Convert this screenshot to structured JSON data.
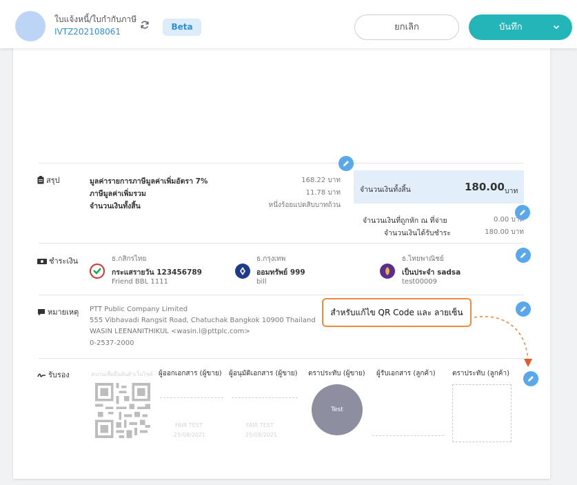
{
  "header": {
    "doc_type": "ใบแจ้งหนี้/ใบกำกับภาษี",
    "doc_number": "IVTZ202108061",
    "beta_label": "Beta",
    "cancel_label": "ยกเลิก",
    "save_label": "บันทึก"
  },
  "colors": {
    "accent": "#24b5b9",
    "link": "#2f8fd8",
    "edit_button": "#5aa8ec",
    "callout_border": "#f08a3c",
    "total_box": "#e3eefb"
  },
  "summary": {
    "label": "สรุป",
    "rows": [
      {
        "label": "มูลค่ารายการภาษีมูลค่าเพิ่มอัตรา 7%",
        "value": "168.22 บาท"
      },
      {
        "label": "ภาษีมูลค่าเพิ่มรวม",
        "value": "11.78 บาท"
      },
      {
        "label": "จำนวนเงินทั้งสิ้น",
        "value": "หนึ่งร้อยแปดสิบบาทถ้วน"
      }
    ],
    "total_label": "จำนวนเงินทั้งสิ้น",
    "total_value": "180.00",
    "total_unit": "บาท",
    "withheld_label": "จำนวนเงินที่ถูกหัก ณ ที่จ่าย",
    "withheld_value": "0.00 บาท",
    "received_label": "จำนวนเงินได้รับชำระ",
    "received_value": "180.00 บาท"
  },
  "payment": {
    "label": "ชำระเงิน",
    "banks": [
      {
        "bank": "ธ.กสิกรไทย",
        "account": "กระแสรายวัน 123456789",
        "note": "Friend BBL 1111",
        "icon": "kasikorn-logo-icon",
        "color": "#1ba94c"
      },
      {
        "bank": "ธ.กรุงเทพ",
        "account": "ออมทรัพย์ 999",
        "note": "bill",
        "icon": "bangkok-bank-logo-icon",
        "color": "#1e3a8a"
      },
      {
        "bank": "ธ.ไทยพาณิชย์",
        "account": "เป็นประจำ sadsa",
        "note": "test00009",
        "icon": "scb-logo-icon",
        "color": "#5b2d8e"
      }
    ]
  },
  "remark": {
    "label": "หมายเหตุ",
    "lines": [
      "PTT Public Company Limited",
      "555 Vibhavadi Rangsit Road, Chatuchak Bangkok 10900 Thailand",
      "WASIN LEENANITHIKUL <wasin.l@pttplc.com>",
      "0-2537-2000"
    ]
  },
  "callout": {
    "text": "สำหรับแก้ไข QR Code และ ลายเซ็น"
  },
  "certify": {
    "label": "รับรอง",
    "scan_hint": "สแกนเพื่อยืนยันตัวเว็บไซต์",
    "columns": [
      "ผู้ออกเอกสาร (ผู้ขาย)",
      "ผู้อนุมัติเอกสาร (ผู้ขาย)",
      "ตราประทับ (ผู้ขาย)",
      "ผู้รับเอกสาร (ลูกค้า)",
      "ตราประทับ (ลูกค้า)"
    ],
    "issuer_name": "FAIR TEST",
    "issuer_date": "25/08/2021",
    "approver_name": "FAIR TEST",
    "approver_date": "25/08/2021",
    "stamp_text": "Test"
  }
}
